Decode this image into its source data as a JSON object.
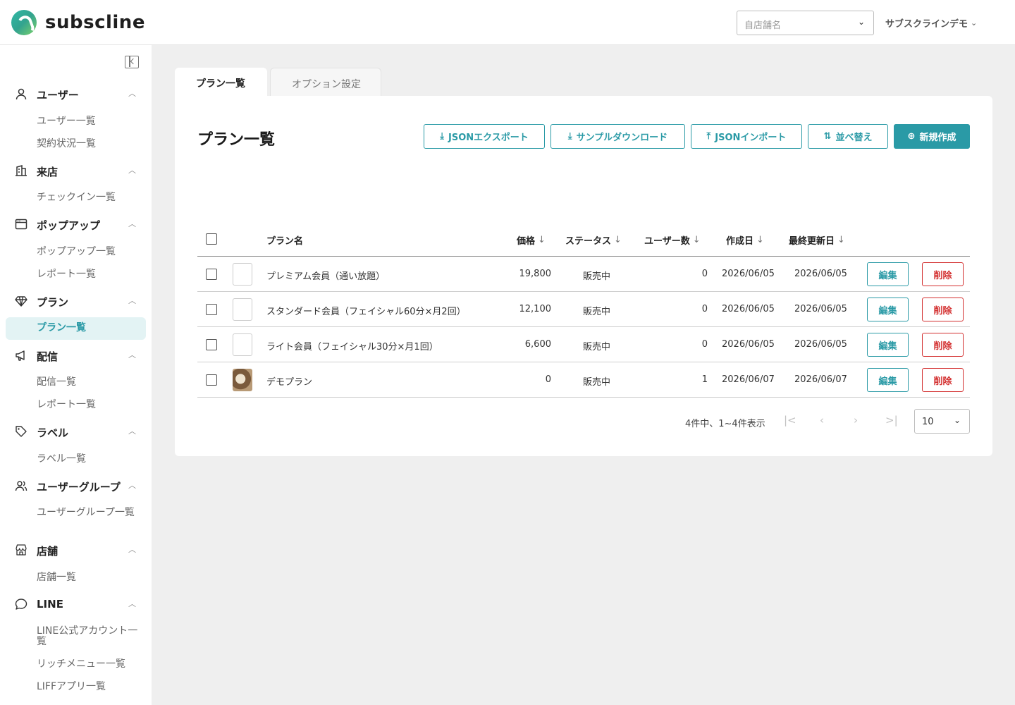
{
  "header": {
    "logo_text": "subscline",
    "store_placeholder": "自店舗名",
    "account_name": "サブスクラインデモ"
  },
  "sidebar": {
    "groups": [
      {
        "icon": "user-icon",
        "label": "ユーザー",
        "items": [
          "ユーザー一覧",
          "契約状況一覧"
        ]
      },
      {
        "icon": "building-icon",
        "label": "来店",
        "items": [
          "チェックイン一覧"
        ]
      },
      {
        "icon": "window-icon",
        "label": "ポップアップ",
        "items": [
          "ポップアップ一覧",
          "レポート一覧"
        ]
      },
      {
        "icon": "gem-icon",
        "label": "プラン",
        "items": [
          "プラン一覧"
        ]
      },
      {
        "icon": "megaphone-icon",
        "label": "配信",
        "items": [
          "配信一覧",
          "レポート一覧"
        ]
      },
      {
        "icon": "tag-icon",
        "label": "ラベル",
        "items": [
          "ラベル一覧"
        ]
      },
      {
        "icon": "users-icon",
        "label": "ユーザーグループ",
        "items": [
          "ユーザーグループ一覧"
        ]
      },
      {
        "icon": "store-icon",
        "label": "店舗",
        "items": [
          "店舗一覧"
        ]
      },
      {
        "icon": "chat-icon",
        "label": "LINE",
        "items": [
          "LINE公式アカウント一覧",
          "リッチメニュー一覧",
          "LIFFアプリ一覧"
        ]
      }
    ],
    "active_item": "プラン一覧"
  },
  "tabs": [
    {
      "label": "プラン一覧",
      "active": true
    },
    {
      "label": "オプション設定",
      "active": false
    }
  ],
  "main": {
    "title": "プラン一覧",
    "actions": {
      "json_export": "JSONエクスポート",
      "sample_download": "サンプルダウンロード",
      "json_import": "JSONインポート",
      "sort": "並べ替え",
      "create": "新規作成"
    },
    "columns": {
      "name": "プラン名",
      "price": "価格",
      "status": "ステータス",
      "users": "ユーザー数",
      "created": "作成日",
      "updated": "最終更新日"
    },
    "rows": [
      {
        "name": "プレミアム会員（通い放題）",
        "price": "19,800",
        "status": "販売中",
        "users": "0",
        "created": "2026/06/05",
        "updated": "2026/06/05",
        "thumb": "empty"
      },
      {
        "name": "スタンダード会員（フェイシャル60分×月2回）",
        "price": "12,100",
        "status": "販売中",
        "users": "0",
        "created": "2026/06/05",
        "updated": "2026/06/05",
        "thumb": "empty"
      },
      {
        "name": "ライト会員（フェイシャル30分×月1回）",
        "price": "6,600",
        "status": "販売中",
        "users": "0",
        "created": "2026/06/05",
        "updated": "2026/06/05",
        "thumb": "empty"
      },
      {
        "name": "デモプラン",
        "price": "0",
        "status": "販売中",
        "users": "1",
        "created": "2026/06/07",
        "updated": "2026/06/07",
        "thumb": "photo"
      }
    ],
    "row_actions": {
      "edit": "編集",
      "delete": "削除"
    },
    "pagination": {
      "info": "4件中、1~4件表示",
      "page_size": "10"
    }
  },
  "colors": {
    "accent": "#2a9aa6",
    "danger": "#d32f2f",
    "background": "#efefef"
  }
}
